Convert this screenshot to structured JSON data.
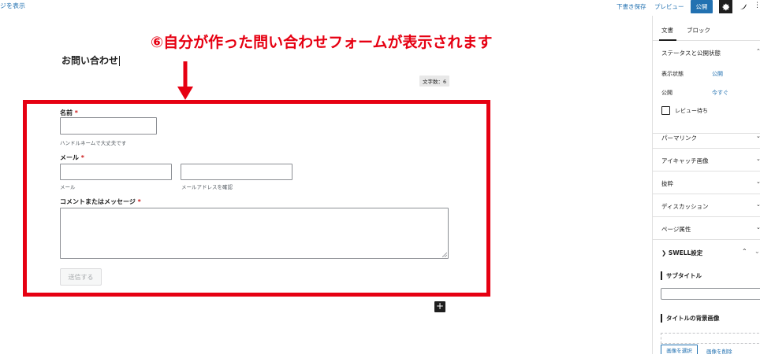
{
  "topbar": {
    "view_link": "ジを表示",
    "save_draft": "下書き保存",
    "preview": "プレビュー",
    "publish": "公開",
    "more": "⋮",
    "accent": "#2271b1"
  },
  "editor": {
    "post_title": "お問い合わせ",
    "char_count": "文字数：6"
  },
  "annotation": {
    "text": "⑥自分が作った問い合わせフォームが表示されます",
    "color": "#e60012"
  },
  "form": {
    "name_label": "名前",
    "required_mark": "*",
    "name_hint": "ハンドルネームで大丈夫です",
    "email_label": "メール",
    "email_hint": "メール",
    "email_confirm_hint": "メールアドレスを確認",
    "message_label": "コメントまたはメッセージ",
    "submit_label": "送信する"
  },
  "add_block": "+",
  "sidebar": {
    "tabs": [
      "文書",
      "ブロック"
    ],
    "status_section": "ステータスと公開状態",
    "visibility_label": "表示状態",
    "visibility_value": "公開",
    "publish_label": "公開",
    "publish_value": "今すぐ",
    "pending_review": "レビュー待ち",
    "sections": [
      "パーマリンク",
      "アイキャッチ画像",
      "抜粋",
      "ディスカッション",
      "ページ属性"
    ],
    "swell_section": "SWELL設定",
    "subtitle_label": "サブタイトル",
    "title_bg_label": "タイトルの背景画像",
    "select_image": "画像を選択",
    "delete_image": "画像を削除"
  }
}
